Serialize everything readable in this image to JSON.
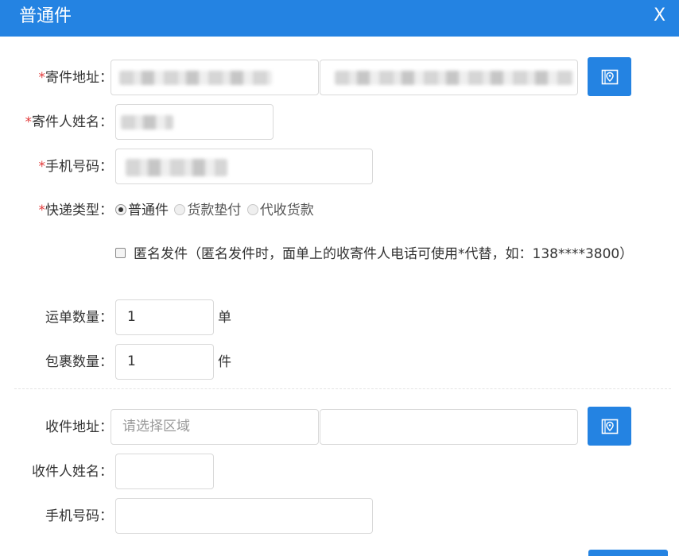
{
  "dialog": {
    "title": "普通件",
    "close_label": "X"
  },
  "sender": {
    "address_label": "寄件地址：",
    "name_label": "寄件人姓名：",
    "phone_label": "手机号码：",
    "express_type_label": "快递类型：",
    "required_mark": "*"
  },
  "express_types": [
    {
      "label": "普通件",
      "checked": true
    },
    {
      "label": "货款垫付",
      "checked": false
    },
    {
      "label": "代收货款",
      "checked": false
    }
  ],
  "anonymous": {
    "label": "匿名发件（匿名发件时，面单上的收寄件人电话可使用*代替，如：138****3800）",
    "checked": false
  },
  "counts": {
    "waybill_label": "运单数量：",
    "waybill_value": "1",
    "waybill_unit": "单",
    "parcel_label": "包裹数量：",
    "parcel_value": "1",
    "parcel_unit": "件"
  },
  "receiver": {
    "address_label": "收件地址：",
    "region_placeholder": "请选择区域",
    "detail_value": "",
    "name_label": "收件人姓名：",
    "name_value": "",
    "phone_label": "手机号码：",
    "phone_value": ""
  },
  "icons": {
    "map": "map-pin-icon"
  },
  "colors": {
    "primary": "#2483e2",
    "required": "#e23b3b"
  }
}
